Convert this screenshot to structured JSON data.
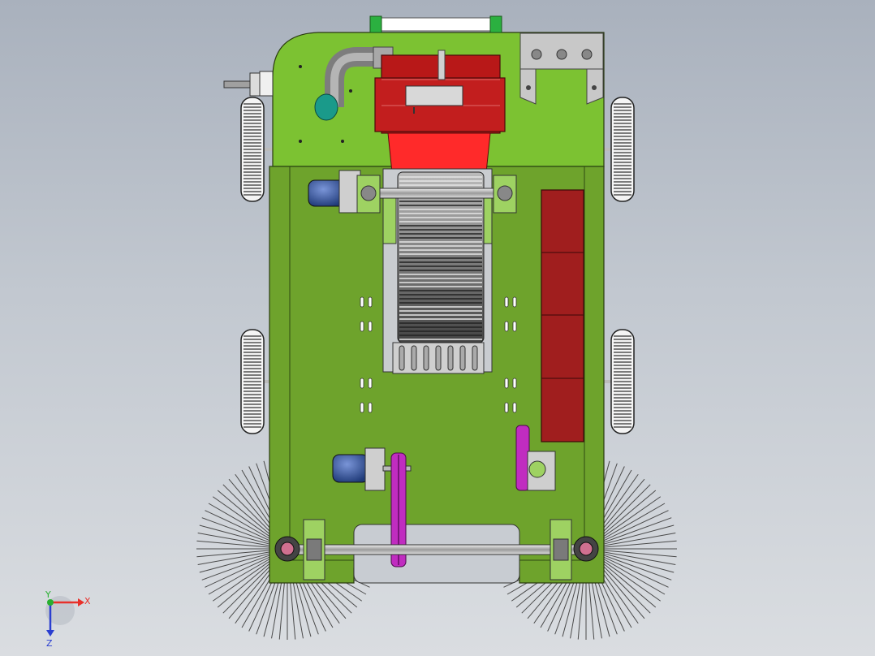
{
  "triad": {
    "x_label": "X",
    "y_label": "Y",
    "z_label": "Z",
    "x_color": "#e8302a",
    "y_color": "#28b030",
    "z_color": "#2b3fd0"
  },
  "colors": {
    "chassis": "#6ea32c",
    "chassis_upper": "#7cc232",
    "hopper_red": "#b81818",
    "hopper_bright": "#ff2a2a",
    "brush_bristle": "#555555",
    "pulley": "#c02cc0",
    "motor_blue": "#3b5fa8",
    "panel_grey": "#c8c8c8"
  },
  "components": [
    "main-brush-roller-icon",
    "side-brush-left-icon",
    "side-brush-right-icon",
    "drive-motor-icon",
    "belt-pulley-icon",
    "wheel-icon",
    "battery-box-icon",
    "suction-pipe-icon"
  ]
}
